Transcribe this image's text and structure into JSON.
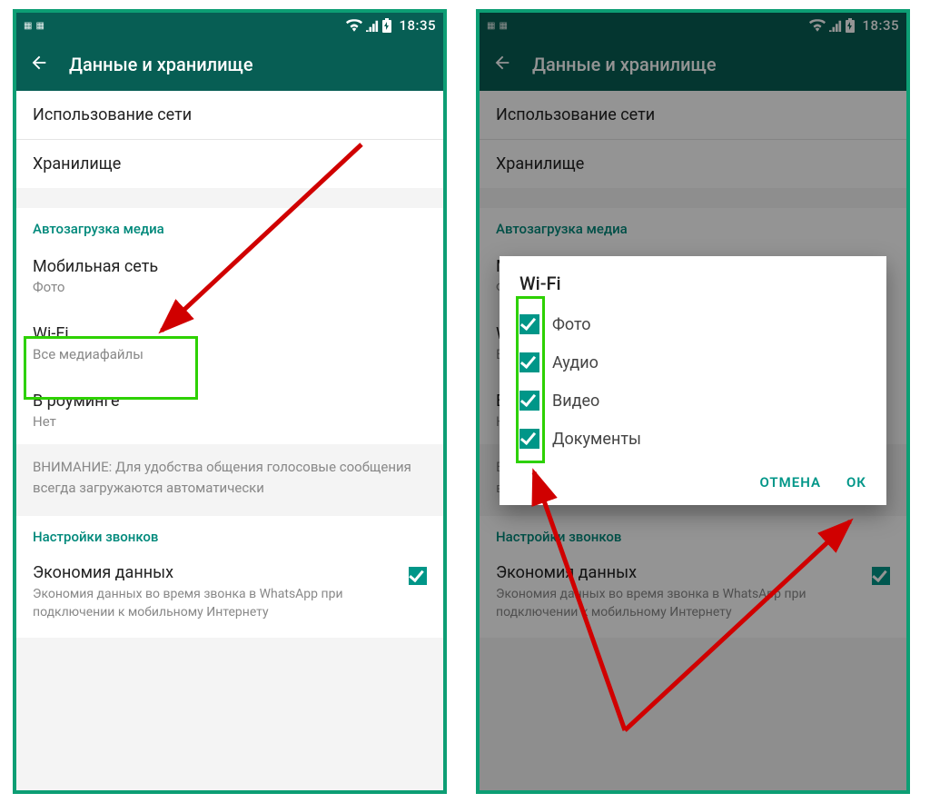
{
  "status": {
    "time": "18:35"
  },
  "appbar": {
    "title": "Данные и хранилище"
  },
  "items": {
    "network_usage": "Использование сети",
    "storage": "Хранилище"
  },
  "sections": {
    "autodownload": "Автозагрузка медиа",
    "calls": "Настройки звонков"
  },
  "autodl": {
    "mobile": {
      "title": "Мобильная сеть",
      "sub": "Фото"
    },
    "wifi": {
      "title": "Wi-Fi",
      "sub": "Все медиафайлы"
    },
    "roaming": {
      "title": "В роуминге",
      "sub": "Нет"
    }
  },
  "notice": "ВНИМАНИЕ: Для удобства общения голосовые сообщения всегда загружаются автоматически",
  "datasaver": {
    "title": "Экономия данных",
    "sub": "Экономия данных во время звонка в WhatsApp при подключении к мобильному Интернету"
  },
  "dialog": {
    "title": "Wi-Fi",
    "options": {
      "photo": "Фото",
      "audio": "Аудио",
      "video": "Видео",
      "docs": "Документы"
    },
    "cancel": "ОТМЕНА",
    "ok": "ОК"
  }
}
